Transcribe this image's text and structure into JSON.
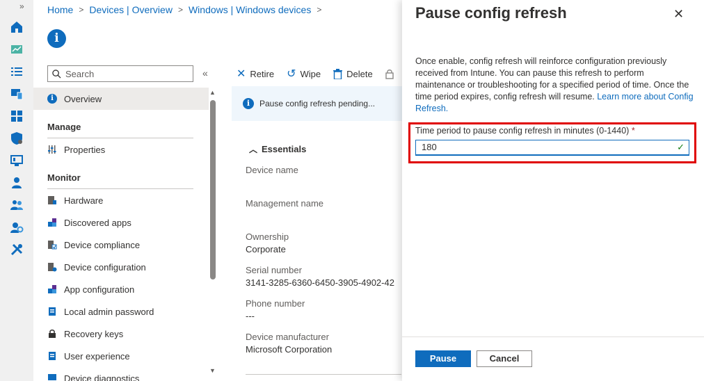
{
  "rail": {
    "expand_glyph": "»",
    "icons": [
      "home-icon",
      "dashboard-icon",
      "list-icon",
      "devices-icon",
      "apps-icon",
      "endpoint-security-icon",
      "reports-icon",
      "users-icon",
      "groups-icon",
      "tenant-admin-icon",
      "troubleshooting-icon"
    ]
  },
  "breadcrumb": {
    "items": [
      "Home",
      "Devices | Overview",
      "Windows | Windows devices"
    ],
    "sep": ">"
  },
  "page_icon": "i",
  "search": {
    "placeholder": "Search",
    "collapse_glyph": "«"
  },
  "nav": {
    "overview": "Overview",
    "manage_title": "Manage",
    "properties": "Properties",
    "monitor_title": "Monitor",
    "items": [
      "Hardware",
      "Discovered apps",
      "Device compliance",
      "Device configuration",
      "App configuration",
      "Local admin password",
      "Recovery keys",
      "User experience",
      "Device diagnostics"
    ]
  },
  "toolbar": {
    "retire": "Retire",
    "wipe": "Wipe",
    "delete": "Delete"
  },
  "banner": {
    "text": "Pause config refresh pending..."
  },
  "essentials": {
    "title": "Essentials",
    "fields": [
      {
        "label": "Device name",
        "value": ""
      },
      {
        "label": "Management name",
        "value": ""
      },
      {
        "label": "Ownership",
        "value": "Corporate"
      },
      {
        "label": "Serial number",
        "value": "3141-3285-6360-6450-3905-4902-42"
      },
      {
        "label": "Phone number",
        "value": "---"
      },
      {
        "label": "Device manufacturer",
        "value": "Microsoft Corporation"
      }
    ]
  },
  "panel": {
    "title": "Pause config refresh",
    "close_glyph": "✕",
    "description": "Once enable, config refresh will reinforce configuration previously received from Intune. You can pause this refresh to perform maintenance or troubleshooting for a specified period of time. Once the time period expires, config refresh will resume.",
    "learn_more": "Learn more about Config Refresh.",
    "field_label": "Time period to pause config refresh in minutes (0-1440)",
    "required_marker": "*",
    "input_value": "180",
    "pause_label": "Pause",
    "cancel_label": "Cancel"
  },
  "colors": {
    "accent": "#0f6cbd",
    "highlight": "#e00000",
    "valid": "#107c10"
  }
}
